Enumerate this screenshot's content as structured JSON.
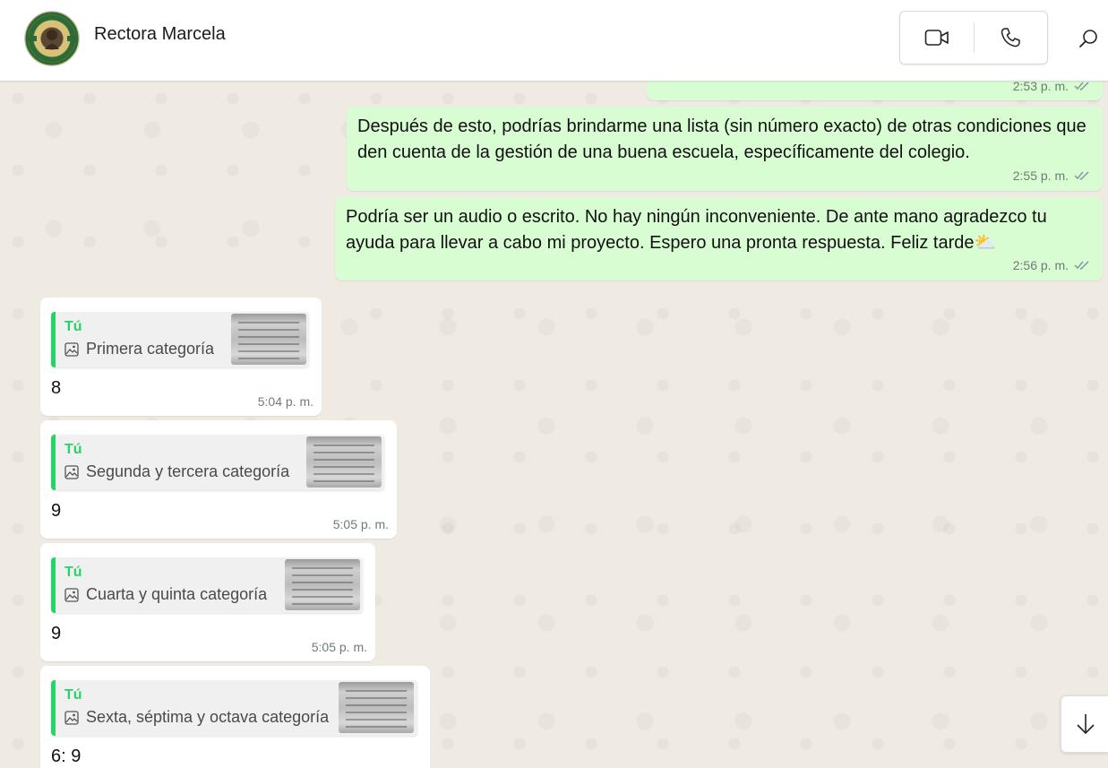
{
  "header": {
    "contact_name": "Rectora Marcela",
    "avatar_icon": "school-crest-logo",
    "video_call_icon": "video-camera-icon",
    "voice_call_icon": "phone-icon",
    "search_icon": "search-icon"
  },
  "outgoing": [
    {
      "text": "",
      "time": "2:53 p. m."
    },
    {
      "text": "Después de esto, podrías brindarme una lista (sin número exacto) de otras condiciones que den cuenta de la gestión de una buena escuela, específicamente del colegio.",
      "time": "2:55 p. m."
    },
    {
      "text": "Podría ser un audio o escrito. No hay ningún inconveniente. De ante mano agradezco tu ayuda para llevar a cabo mi proyecto. Espero una pronta respuesta. Feliz tarde",
      "emoji": "⛅",
      "time": "2:56 p. m."
    }
  ],
  "incoming": [
    {
      "quote_author": "Tú",
      "quote_text": "Primera categoría",
      "text": "8",
      "time": "5:04 p. m."
    },
    {
      "quote_author": "Tú",
      "quote_text": "Segunda y tercera categoría",
      "text": "9",
      "time": "5:05 p. m."
    },
    {
      "quote_author": "Tú",
      "quote_text": "Cuarta y quinta categoría",
      "text": "9",
      "time": "5:05 p. m."
    },
    {
      "quote_author": "Tú",
      "quote_text": "Sexta, séptima y octava categoría",
      "text": "6: 9",
      "time": ""
    }
  ],
  "colors": {
    "outgoing_bubble": "#d9fdd3",
    "incoming_bubble": "#ffffff",
    "accent": "#25d366"
  }
}
